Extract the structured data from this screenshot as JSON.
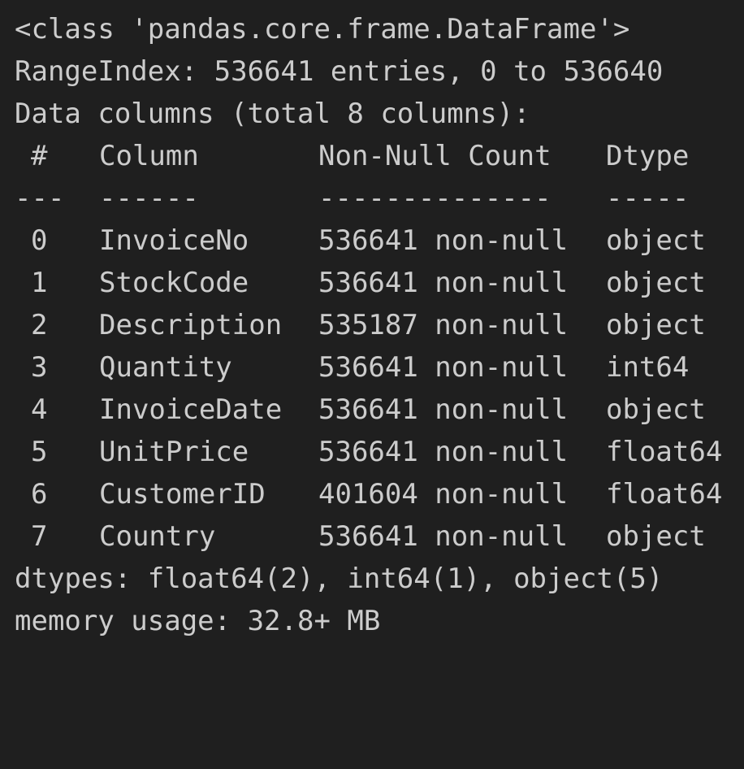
{
  "header": {
    "class_line": "<class 'pandas.core.frame.DataFrame'>",
    "range_index": "RangeIndex: 536641 entries, 0 to 536640",
    "data_columns": "Data columns (total 8 columns):"
  },
  "table": {
    "headers": {
      "index": "#",
      "column": "Column",
      "count": "Non-Null Count",
      "dtype": "Dtype"
    },
    "separators": {
      "index": "---",
      "column": "------",
      "count": "--------------",
      "dtype": "-----"
    },
    "rows": [
      {
        "index": "0",
        "column": "InvoiceNo",
        "count": "536641 non-null",
        "dtype": "object"
      },
      {
        "index": "1",
        "column": "StockCode",
        "count": "536641 non-null",
        "dtype": "object"
      },
      {
        "index": "2",
        "column": "Description",
        "count": "535187 non-null",
        "dtype": "object"
      },
      {
        "index": "3",
        "column": "Quantity",
        "count": "536641 non-null",
        "dtype": "int64"
      },
      {
        "index": "4",
        "column": "InvoiceDate",
        "count": "536641 non-null",
        "dtype": "object"
      },
      {
        "index": "5",
        "column": "UnitPrice",
        "count": "536641 non-null",
        "dtype": "float64"
      },
      {
        "index": "6",
        "column": "CustomerID",
        "count": "401604 non-null",
        "dtype": "float64"
      },
      {
        "index": "7",
        "column": "Country",
        "count": "536641 non-null",
        "dtype": "object"
      }
    ]
  },
  "footer": {
    "dtypes": "dtypes: float64(2), int64(1), object(5)",
    "memory": "memory usage: 32.8+ MB"
  },
  "colors": {
    "background": "#1f1f1f",
    "text": "#cccccc"
  }
}
